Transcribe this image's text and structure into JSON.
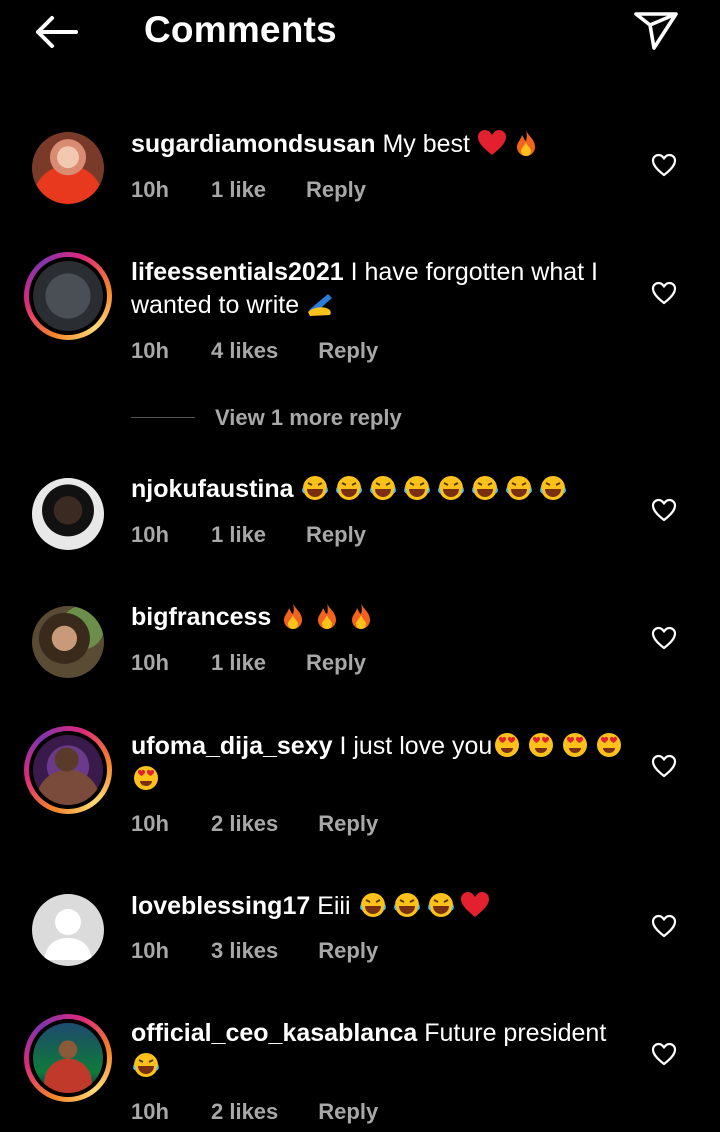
{
  "header": {
    "title": "Comments",
    "back_icon": "arrow-left-icon",
    "send_icon": "paper-plane-icon"
  },
  "colors": {
    "background": "#000000",
    "text": "#ffffff",
    "meta": "#a8a8a8",
    "story_ring": "#dd2a7b"
  },
  "comments": [
    {
      "username": "sugardiamondsusan",
      "text": "My best",
      "emojis": [
        "heart",
        "fire"
      ],
      "time": "10h",
      "likes": "1 like",
      "reply": "Reply",
      "avatar": "photo"
    },
    {
      "username": "lifeessentials2021",
      "text": "I have forgotten what I wanted to write",
      "emojis": [
        "writing-hand"
      ],
      "time": "10h",
      "likes": "4 likes",
      "reply": "Reply",
      "avatar": "photo"
    },
    {
      "username": "njokufaustina",
      "text": "",
      "emojis": [
        "laugh",
        "laugh",
        "laugh",
        "laugh",
        "laugh",
        "laugh",
        "laugh",
        "laugh"
      ],
      "time": "10h",
      "likes": "1 like",
      "reply": "Reply",
      "avatar": "photo"
    },
    {
      "username": "bigfrancess",
      "text": "",
      "emojis": [
        "fire",
        "fire",
        "fire"
      ],
      "time": "10h",
      "likes": "1 like",
      "reply": "Reply",
      "avatar": "photo"
    },
    {
      "username": "ufoma_dija_sexy",
      "text": "I just love you",
      "emojis": [
        "heart-eyes",
        "heart-eyes",
        "heart-eyes",
        "heart-eyes",
        "heart-eyes"
      ],
      "time": "10h",
      "likes": "2 likes",
      "reply": "Reply",
      "avatar": "photo"
    },
    {
      "username": "loveblessing17",
      "text": "Eiii",
      "emojis": [
        "laugh",
        "laugh",
        "laugh",
        "heart"
      ],
      "time": "10h",
      "likes": "3 likes",
      "reply": "Reply",
      "avatar": "default"
    },
    {
      "username": "official_ceo_kasablanca",
      "text": "Future president",
      "emojis": [
        "laugh"
      ],
      "time": "10h",
      "likes": "2 likes",
      "reply": "Reply",
      "avatar": "photo"
    }
  ],
  "view_more_replies": "View 1 more reply"
}
